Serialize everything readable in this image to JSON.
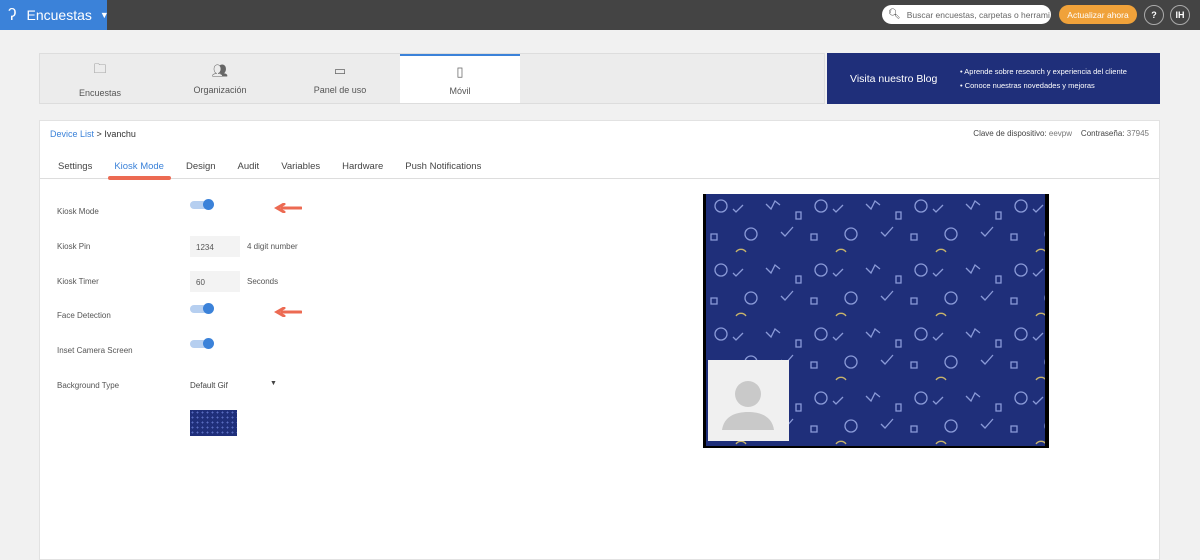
{
  "topbar": {
    "app": "Encuestas",
    "search_placeholder": "Buscar encuestas, carpetas o herrami",
    "update": "Actualizar ahora",
    "help": "?",
    "user": "IH"
  },
  "nav": [
    {
      "label": "Encuestas",
      "icon": "folder-icon"
    },
    {
      "label": "Organización",
      "icon": "users-add-icon"
    },
    {
      "label": "Panel de uso",
      "icon": "dashboard-icon"
    },
    {
      "label": "Móvil",
      "icon": "mobile-icon",
      "active": true
    }
  ],
  "blog": {
    "title": "Visita nuestro Blog",
    "items": [
      "Aprende sobre research y experiencia del cliente",
      "Conoce nuestras novedades y mejoras"
    ]
  },
  "breadcrumb": {
    "root": "Device List",
    "sep": ">",
    "current": "Ivanchu"
  },
  "device": {
    "key_label": "Clave de dispositivo:",
    "key": "eevpw",
    "pass_label": "Contraseña:",
    "pass": "37945"
  },
  "tabs": [
    "Settings",
    "Kiosk Mode",
    "Design",
    "Audit",
    "Variables",
    "Hardware",
    "Push Notifications"
  ],
  "form": {
    "kiosk_mode": {
      "label": "Kiosk Mode",
      "on": true
    },
    "kiosk_pin": {
      "label": "Kiosk Pin",
      "value": "1234",
      "unit": "4 digit number"
    },
    "kiosk_timer": {
      "label": "Kiosk Timer",
      "value": "60",
      "unit": "Seconds"
    },
    "face_detection": {
      "label": "Face Detection",
      "on": true
    },
    "inset_camera": {
      "label": "Inset Camera Screen",
      "on": true
    },
    "background_type": {
      "label": "Background Type",
      "value": "Default Gif"
    }
  },
  "colors": {
    "accent": "#3b82d9",
    "navy": "#1f2f7a",
    "orange": "#f0a23a",
    "annotation": "#ec6a52"
  }
}
